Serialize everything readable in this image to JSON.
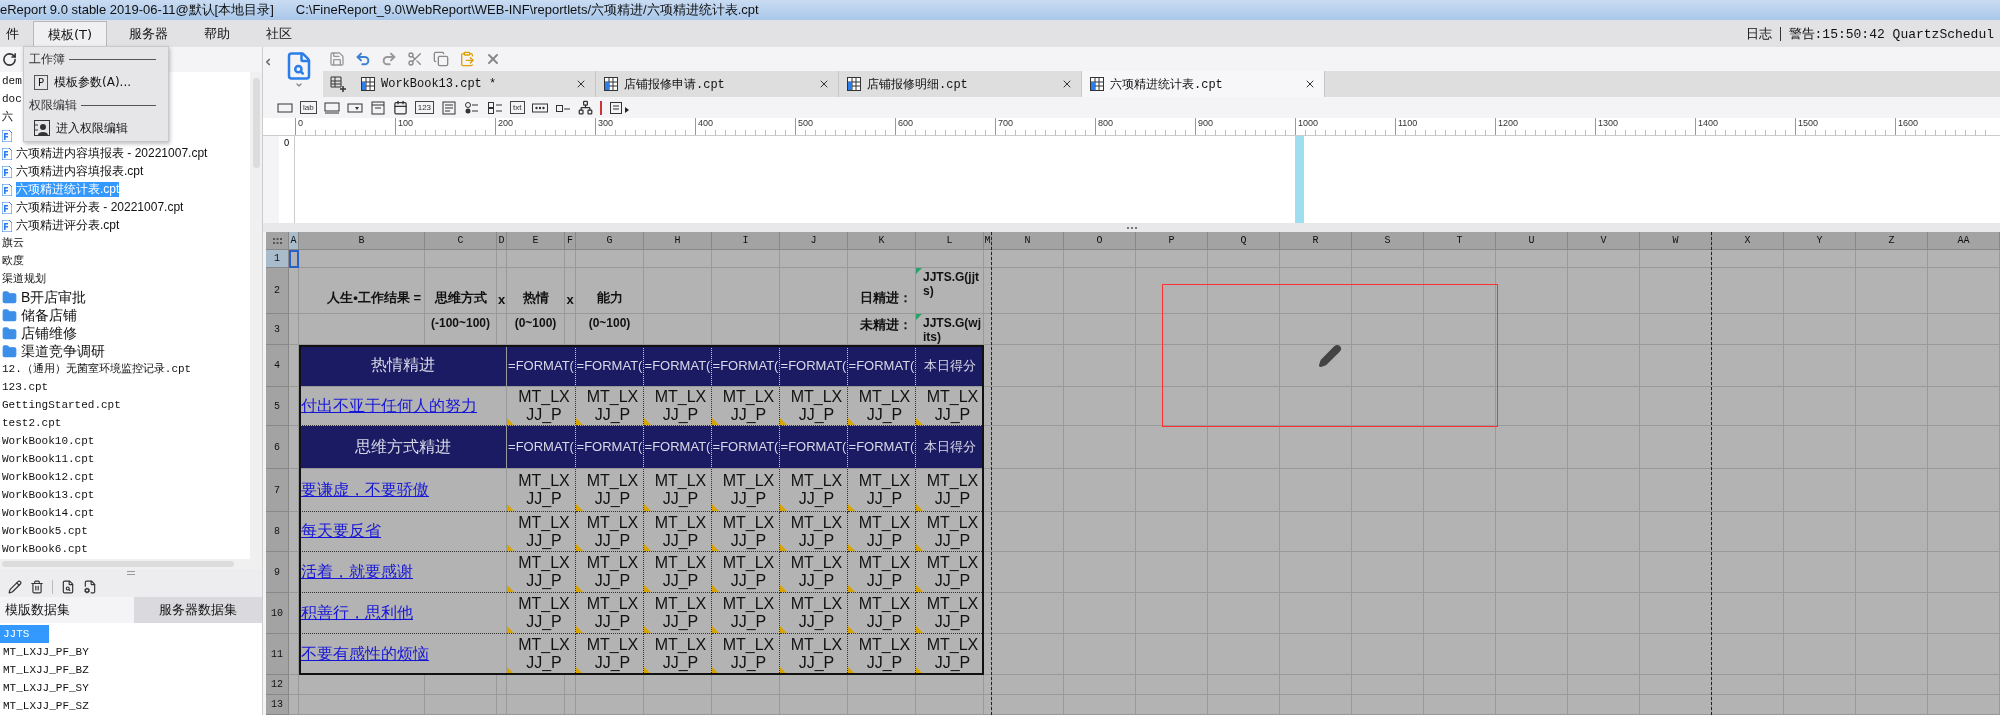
{
  "title_bar": {
    "app": "eReport 9.0 stable 2019-06-11@默认[本地目录]",
    "path": "C:\\FineReport_9.0\\WebReport\\WEB-INF\\reportlets/六项精进/六项精进统计表.cpt"
  },
  "menu_bar": {
    "items": [
      {
        "label": "件",
        "selected": false
      },
      {
        "label": "模板(T)",
        "selected": true
      },
      {
        "label": "服务器",
        "selected": false
      },
      {
        "label": "帮助",
        "selected": false
      },
      {
        "label": "社区",
        "selected": false
      }
    ],
    "log": "日志",
    "warning": "警告:15:50:42 QuartzSchedul"
  },
  "open_menu": {
    "items": [
      {
        "kind": "header",
        "label": "工作簿"
      },
      {
        "kind": "item",
        "key": "P",
        "label": "模板参数(A)..."
      },
      {
        "kind": "header",
        "label": "权限编辑"
      },
      {
        "kind": "item",
        "label": "进入权限编辑"
      }
    ]
  },
  "file_tree": {
    "items": [
      {
        "kind": "text",
        "label": "dem",
        "selected": false
      },
      {
        "kind": "text",
        "label": "doc",
        "selected": false
      },
      {
        "kind": "text",
        "label": "六",
        "selected": false
      },
      {
        "kind": "file"
      },
      {
        "kind": "file",
        "label": "六项精进内容填报表 - 20221007.cpt",
        "selected": false
      },
      {
        "kind": "file",
        "label": "六项精进内容填报表.cpt",
        "selected": false
      },
      {
        "kind": "file",
        "label": "六项精进统计表.cpt",
        "selected": true
      },
      {
        "kind": "file",
        "label": "六项精进评分表 - 20221007.cpt",
        "selected": false
      },
      {
        "kind": "file",
        "label": "六项精进评分表.cpt",
        "selected": false
      },
      {
        "kind": "text",
        "label": "旗云",
        "selected": false
      },
      {
        "kind": "text",
        "label": "欧度",
        "selected": false
      },
      {
        "kind": "text",
        "label": "渠道规划",
        "selected": false
      },
      {
        "kind": "folder",
        "label": "B开店审批",
        "selected": false
      },
      {
        "kind": "folder",
        "label": "储备店铺",
        "selected": false
      },
      {
        "kind": "folder",
        "label": "店铺维修",
        "selected": false
      },
      {
        "kind": "folder",
        "label": "渠道竞争调研",
        "selected": false
      },
      {
        "kind": "text",
        "label": "12.（通用）无菌室环境监控记录.cpt",
        "selected": false
      },
      {
        "kind": "text",
        "label": "123.cpt",
        "selected": false
      },
      {
        "kind": "text",
        "label": "GettingStarted.cpt",
        "selected": false
      },
      {
        "kind": "text",
        "label": "test2.cpt",
        "selected": false
      },
      {
        "kind": "text",
        "label": "WorkBook10.cpt",
        "selected": false
      },
      {
        "kind": "text",
        "label": "WorkBook11.cpt",
        "selected": false
      },
      {
        "kind": "text",
        "label": "WorkBook12.cpt",
        "selected": false
      },
      {
        "kind": "text",
        "label": "WorkBook13.cpt",
        "selected": false
      },
      {
        "kind": "text",
        "label": "WorkBook14.cpt",
        "selected": false
      },
      {
        "kind": "text",
        "label": "WorkBook5.cpt",
        "selected": false
      },
      {
        "kind": "text",
        "label": "WorkBook6.cpt",
        "selected": false
      }
    ]
  },
  "data_sets": {
    "tabs": [
      {
        "label": "模版数据集",
        "selected": true
      },
      {
        "label": "服务器数据集",
        "selected": false
      }
    ],
    "items": [
      {
        "label": "JJTS",
        "selected": true
      },
      {
        "label": "MT_LXJJ_PF_BY",
        "selected": false
      },
      {
        "label": "MT_LXJJ_PF_BZ",
        "selected": false
      },
      {
        "label": "MT_LXJJ_PF_SY",
        "selected": false
      },
      {
        "label": "MT_LXJJ_PF_SZ",
        "selected": false
      }
    ]
  },
  "template_tabs": [
    {
      "label": "WorkBook13.cpt *",
      "selected": false
    },
    {
      "label": "店铺报修申请.cpt",
      "selected": false
    },
    {
      "label": "店铺报修明细.cpt",
      "selected": false
    },
    {
      "label": "六项精进统计表.cpt",
      "selected": true
    }
  ],
  "widget_palette": [
    {
      "kind": "textfield"
    },
    {
      "kind": "glyph",
      "glyph": "lab"
    },
    {
      "kind": "button"
    },
    {
      "kind": "combo"
    },
    {
      "kind": "window"
    },
    {
      "kind": "calendar"
    },
    {
      "kind": "glyph",
      "glyph": "123"
    },
    {
      "kind": "textarea"
    },
    {
      "kind": "radio"
    },
    {
      "kind": "checkbox"
    },
    {
      "kind": "glyph",
      "glyph": "txt"
    },
    {
      "kind": "password"
    },
    {
      "kind": "check"
    },
    {
      "kind": "tree"
    },
    {
      "kind": "separator"
    },
    {
      "kind": "more"
    }
  ],
  "ruler": {
    "ticks": [
      "0",
      "100",
      "200",
      "300",
      "400",
      "500",
      "600",
      "700",
      "800",
      "900",
      "1000",
      "1100",
      "1200",
      "1300",
      "1400",
      "1500",
      "1600"
    ],
    "side": "0"
  },
  "sheet": {
    "columns": [
      "A",
      "B",
      "C",
      "D",
      "E",
      "F",
      "G",
      "H",
      "I",
      "J",
      "K",
      "L",
      "M",
      "N",
      "O",
      "P",
      "Q",
      "R",
      "S",
      "T",
      "U",
      "V",
      "W",
      "X",
      "Y",
      "Z",
      "AA"
    ],
    "rows": [
      {
        "number": "1",
        "cells": [
          {
            "kind": "empty",
            "selected": true
          }
        ]
      },
      {
        "number": "2",
        "cells": [
          {
            "kind": "empty"
          },
          {
            "kind": "labelright",
            "text": "人生•工作结果 ="
          },
          {
            "kind": "label",
            "text": "思维方式"
          },
          {
            "kind": "label",
            "text": "x"
          },
          {
            "kind": "label",
            "text": "热情"
          },
          {
            "kind": "label",
            "text": "x"
          },
          {
            "kind": "label",
            "text": "能力"
          },
          {
            "kind": "empty"
          },
          {
            "kind": "empty"
          },
          {
            "kind": "empty"
          },
          {
            "kind": "labelright",
            "text": "日精进："
          },
          {
            "kind": "code",
            "text": "JJTS.G(jjts)"
          }
        ]
      },
      {
        "number": "3",
        "cells": [
          {
            "kind": "empty"
          },
          {
            "kind": "empty"
          },
          {
            "kind": "note",
            "text": "(-100~100)"
          },
          {
            "kind": "empty"
          },
          {
            "kind": "note",
            "text": "(0~100)"
          },
          {
            "kind": "empty"
          },
          {
            "kind": "note",
            "text": "(0~100)"
          },
          {
            "kind": "empty"
          },
          {
            "kind": "empty"
          },
          {
            "kind": "empty"
          },
          {
            "kind": "noteright",
            "text": "未精进："
          },
          {
            "kind": "code",
            "text": "JJTS.G(wjits)"
          }
        ]
      },
      {
        "number": "4",
        "cells": [
          {
            "kind": "empty"
          },
          {
            "kind": "title",
            "text": "热情精进"
          },
          {
            "kind": "merged"
          },
          {
            "kind": "merged"
          },
          {
            "kind": "formula",
            "text": "=FORMAT("
          },
          {
            "kind": "merged"
          },
          {
            "kind": "formula",
            "text": "=FORMAT("
          },
          {
            "kind": "formula",
            "text": "=FORMAT("
          },
          {
            "kind": "formula",
            "text": "=FORMAT("
          },
          {
            "kind": "formula",
            "text": "=FORMAT("
          },
          {
            "kind": "formula",
            "text": "=FORMAT("
          },
          {
            "kind": "score",
            "text": "本日得分"
          }
        ]
      },
      {
        "number": "5",
        "cells": [
          {
            "kind": "empty"
          },
          {
            "kind": "link",
            "text": "付出不亚于任何人的努力"
          },
          {
            "kind": "merged"
          },
          {
            "kind": "merged"
          },
          {
            "kind": "data",
            "text": "MT_LXJJ_P"
          },
          {
            "kind": "merged"
          },
          {
            "kind": "data",
            "text": "MT_LXJJ_P"
          },
          {
            "kind": "data",
            "text": "MT_LXJJ_P"
          },
          {
            "kind": "data",
            "text": "MT_LXJJ_P"
          },
          {
            "kind": "data",
            "text": "MT_LXJJ_P"
          },
          {
            "kind": "data",
            "text": "MT_LXJJ_P"
          },
          {
            "kind": "data",
            "text": "MT_LXJJ_P"
          }
        ]
      },
      {
        "number": "6",
        "cells": [
          {
            "kind": "empty"
          },
          {
            "kind": "title",
            "text": "思维方式精进"
          },
          {
            "kind": "merged"
          },
          {
            "kind": "merged"
          },
          {
            "kind": "formula",
            "text": "=FORMAT("
          },
          {
            "kind": "merged"
          },
          {
            "kind": "formula",
            "text": "=FORMAT("
          },
          {
            "kind": "formula",
            "text": "=FORMAT("
          },
          {
            "kind": "formula",
            "text": "=FORMAT("
          },
          {
            "kind": "formula",
            "text": "=FORMAT("
          },
          {
            "kind": "formula",
            "text": "=FORMAT("
          },
          {
            "kind": "score",
            "text": "本日得分"
          }
        ]
      },
      {
        "number": "7",
        "cells": [
          {
            "kind": "empty"
          },
          {
            "kind": "link",
            "text": "要谦虚，不要骄傲"
          },
          {
            "kind": "merged"
          },
          {
            "kind": "merged"
          },
          {
            "kind": "data",
            "text": "MT_LXJJ_P"
          },
          {
            "kind": "merged"
          },
          {
            "kind": "data",
            "text": "MT_LXJJ_P"
          },
          {
            "kind": "data",
            "text": "MT_LXJJ_P"
          },
          {
            "kind": "data",
            "text": "MT_LXJJ_P"
          },
          {
            "kind": "data",
            "text": "MT_LXJJ_P"
          },
          {
            "kind": "data",
            "text": "MT_LXJJ_P"
          },
          {
            "kind": "data",
            "text": "MT_LXJJ_P"
          }
        ]
      },
      {
        "number": "8",
        "cells": [
          {
            "kind": "empty"
          },
          {
            "kind": "link",
            "text": "每天要反省"
          },
          {
            "kind": "merged"
          },
          {
            "kind": "merged"
          },
          {
            "kind": "data",
            "text": "MT_LXJJ_P"
          },
          {
            "kind": "merged"
          },
          {
            "kind": "data",
            "text": "MT_LXJJ_P"
          },
          {
            "kind": "data",
            "text": "MT_LXJJ_P"
          },
          {
            "kind": "data",
            "text": "MT_LXJJ_P"
          },
          {
            "kind": "data",
            "text": "MT_LXJJ_P"
          },
          {
            "kind": "data",
            "text": "MT_LXJJ_P"
          },
          {
            "kind": "data",
            "text": "MT_LXJJ_P"
          }
        ]
      },
      {
        "number": "9",
        "cells": [
          {
            "kind": "empty"
          },
          {
            "kind": "link",
            "text": "活着，就要感谢"
          },
          {
            "kind": "merged"
          },
          {
            "kind": "merged"
          },
          {
            "kind": "data",
            "text": "MT_LXJJ_P"
          },
          {
            "kind": "merged"
          },
          {
            "kind": "data",
            "text": "MT_LXJJ_P"
          },
          {
            "kind": "data",
            "text": "MT_LXJJ_P"
          },
          {
            "kind": "data",
            "text": "MT_LXJJ_P"
          },
          {
            "kind": "data",
            "text": "MT_LXJJ_P"
          },
          {
            "kind": "data",
            "text": "MT_LXJJ_P"
          },
          {
            "kind": "data",
            "text": "MT_LXJJ_P"
          }
        ]
      },
      {
        "number": "10",
        "cells": [
          {
            "kind": "empty"
          },
          {
            "kind": "link",
            "text": "积善行，思利他"
          },
          {
            "kind": "merged"
          },
          {
            "kind": "merged"
          },
          {
            "kind": "data",
            "text": "MT_LXJJ_P"
          },
          {
            "kind": "merged"
          },
          {
            "kind": "data",
            "text": "MT_LXJJ_P"
          },
          {
            "kind": "data",
            "text": "MT_LXJJ_P"
          },
          {
            "kind": "data",
            "text": "MT_LXJJ_P"
          },
          {
            "kind": "data",
            "text": "MT_LXJJ_P"
          },
          {
            "kind": "data",
            "text": "MT_LXJJ_P"
          },
          {
            "kind": "data",
            "text": "MT_LXJJ_P"
          }
        ]
      },
      {
        "number": "11",
        "cells": [
          {
            "kind": "empty"
          },
          {
            "kind": "link",
            "text": "不要有感性的烦恼"
          },
          {
            "kind": "merged"
          },
          {
            "kind": "merged"
          },
          {
            "kind": "data",
            "text": "MT_LXJJ_P"
          },
          {
            "kind": "merged"
          },
          {
            "kind": "data",
            "text": "MT_LXJJ_P"
          },
          {
            "kind": "data",
            "text": "MT_LXJJ_P"
          },
          {
            "kind": "data",
            "text": "MT_LXJJ_P"
          },
          {
            "kind": "data",
            "text": "MT_LXJJ_P"
          },
          {
            "kind": "data",
            "text": "MT_LXJJ_P"
          },
          {
            "kind": "data",
            "text": "MT_LXJJ_P"
          }
        ]
      },
      {
        "number": "12",
        "cells": []
      },
      {
        "number": "13",
        "cells": []
      }
    ]
  }
}
